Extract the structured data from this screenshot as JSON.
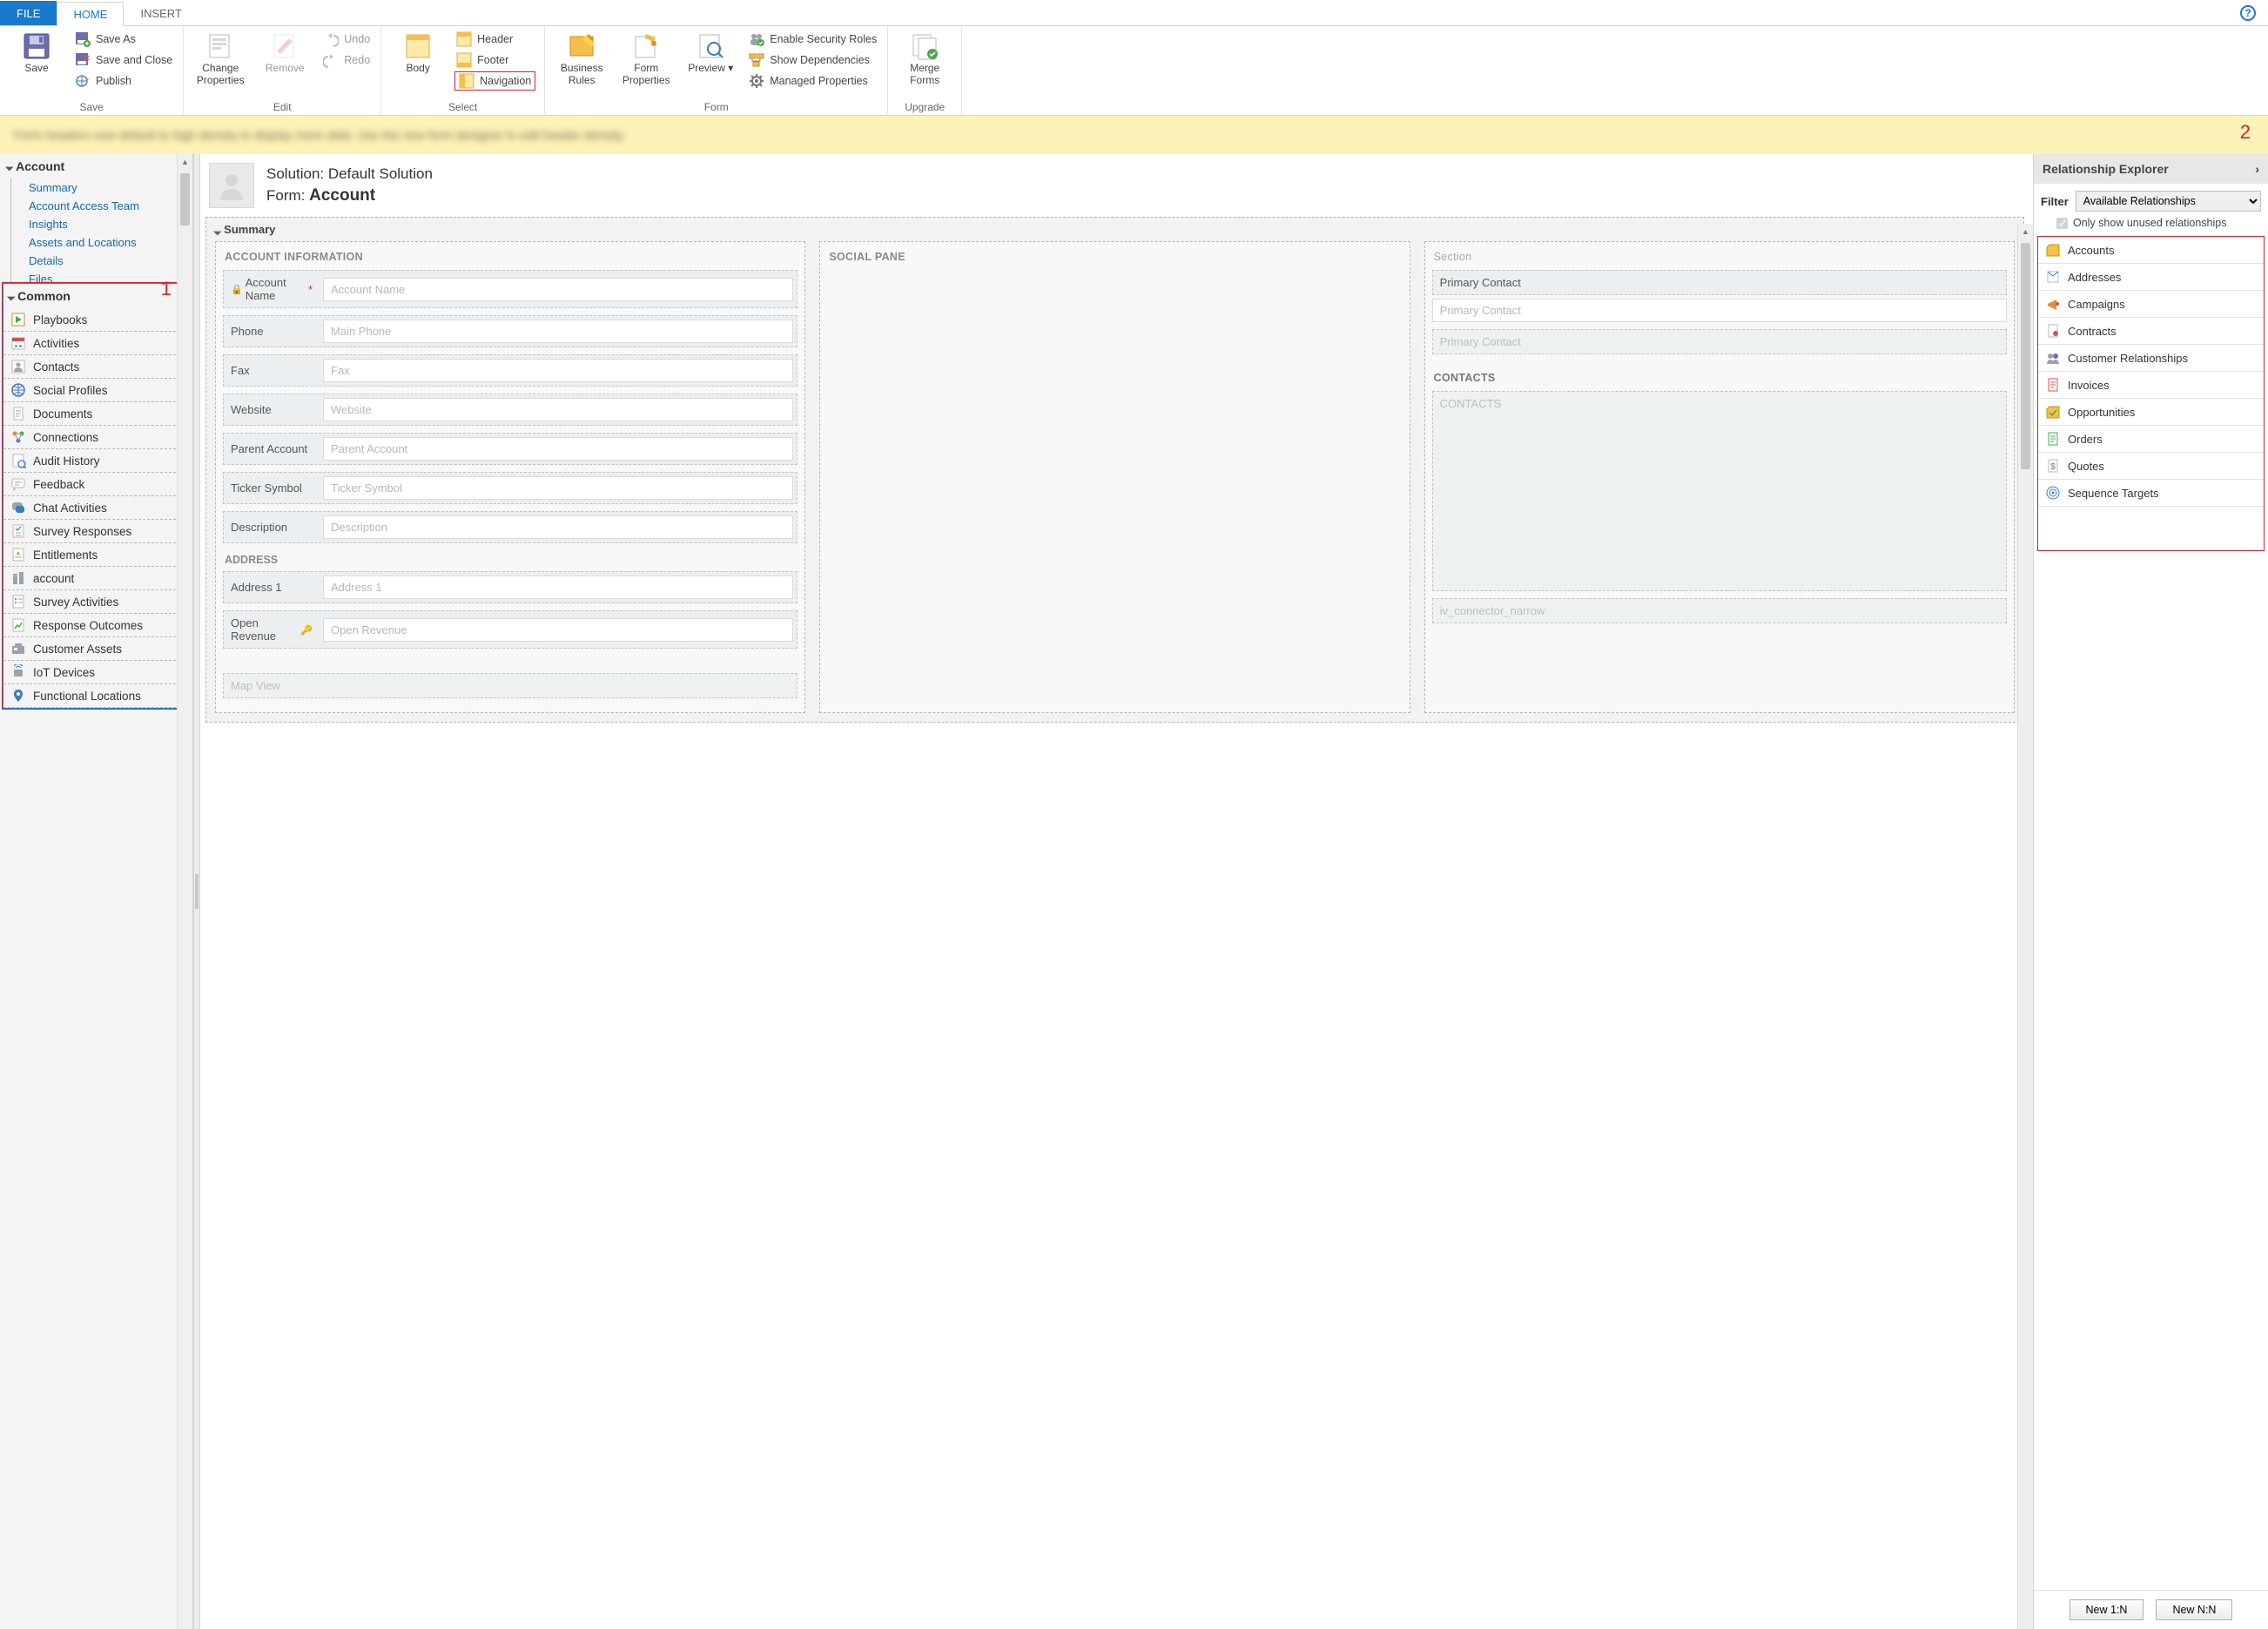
{
  "tabs": {
    "file": "FILE",
    "home": "HOME",
    "insert": "INSERT"
  },
  "ribbon": {
    "save_group": "Save",
    "save": "Save",
    "save_as": "Save As",
    "save_close": "Save and Close",
    "publish": "Publish",
    "edit_group": "Edit",
    "change_props": "Change Properties",
    "remove": "Remove",
    "undo": "Undo",
    "redo": "Redo",
    "select_group": "Select",
    "body": "Body",
    "header": "Header",
    "footer": "Footer",
    "navigation": "Navigation",
    "form_group": "Form",
    "biz_rules": "Business Rules",
    "form_props": "Form Properties",
    "preview": "Preview",
    "enable_sec": "Enable Security Roles",
    "show_dep": "Show Dependencies",
    "managed_props": "Managed Properties",
    "upgrade_group": "Upgrade",
    "merge_forms": "Merge Forms"
  },
  "info_bar": "Form headers now default to high density to display more data. Use the new form designer to edit header density.",
  "markers": {
    "one": "1",
    "two": "2"
  },
  "leftnav": {
    "account": "Account",
    "links": [
      "Summary",
      "Account Access Team",
      "Insights",
      "Assets and Locations",
      "Details",
      "Files"
    ],
    "common": "Common",
    "common_items": [
      "Playbooks",
      "Activities",
      "Contacts",
      "Social Profiles",
      "Documents",
      "Connections",
      "Audit History",
      "Feedback",
      "Chat Activities",
      "Survey Responses",
      "Entitlements",
      "account",
      "Survey Activities",
      "Response Outcomes",
      "Customer Assets",
      "IoT Devices",
      "Functional Locations"
    ]
  },
  "form_header": {
    "solution_pfx": "Solution: ",
    "solution": "Default Solution",
    "form_pfx": "Form: ",
    "form": "Account"
  },
  "summary": {
    "title": "Summary",
    "col1_title": "ACCOUNT INFORMATION",
    "fields": [
      {
        "label": "Account Name",
        "ph": "Account Name",
        "locked": true,
        "required": true
      },
      {
        "label": "Phone",
        "ph": "Main Phone"
      },
      {
        "label": "Fax",
        "ph": "Fax"
      },
      {
        "label": "Website",
        "ph": "Website"
      },
      {
        "label": "Parent Account",
        "ph": "Parent Account"
      },
      {
        "label": "Ticker Symbol",
        "ph": "Ticker Symbol"
      },
      {
        "label": "Description",
        "ph": "Description"
      }
    ],
    "address_title": "ADDRESS",
    "addr_fields": [
      {
        "label": "Address 1",
        "ph": "Address 1"
      },
      {
        "label": "Open Revenue",
        "ph": "Open Revenue",
        "key": true
      }
    ],
    "map_view": "Map View",
    "col2_title": "SOCIAL PANE",
    "col3_title": "Section",
    "primary_contact_label": "Primary Contact",
    "primary_contact_ph": "Primary Contact",
    "contacts_title": "CONTACTS",
    "contacts_ph": "CONTACTS",
    "iv_conn": "iv_connector_narrow"
  },
  "rightpanel": {
    "title": "Relationship Explorer",
    "filter_label": "Filter",
    "filter_value": "Available Relationships",
    "only_unused": "Only show unused relationships",
    "items": [
      "Accounts",
      "Addresses",
      "Campaigns",
      "Contracts",
      "Customer Relationships",
      "Invoices",
      "Opportunities",
      "Orders",
      "Quotes",
      "Sequence Targets"
    ],
    "new_1n": "New 1:N",
    "new_nn": "New N:N"
  },
  "colors": {
    "folder": "#f4c04a",
    "folder_stroke": "#c58f1d",
    "blue": "#3b7bbf",
    "green": "#4aa84a",
    "red": "#d45050",
    "purple": "#8a5bd8",
    "orange": "#e88b2e",
    "gray": "#9aa3ab"
  }
}
